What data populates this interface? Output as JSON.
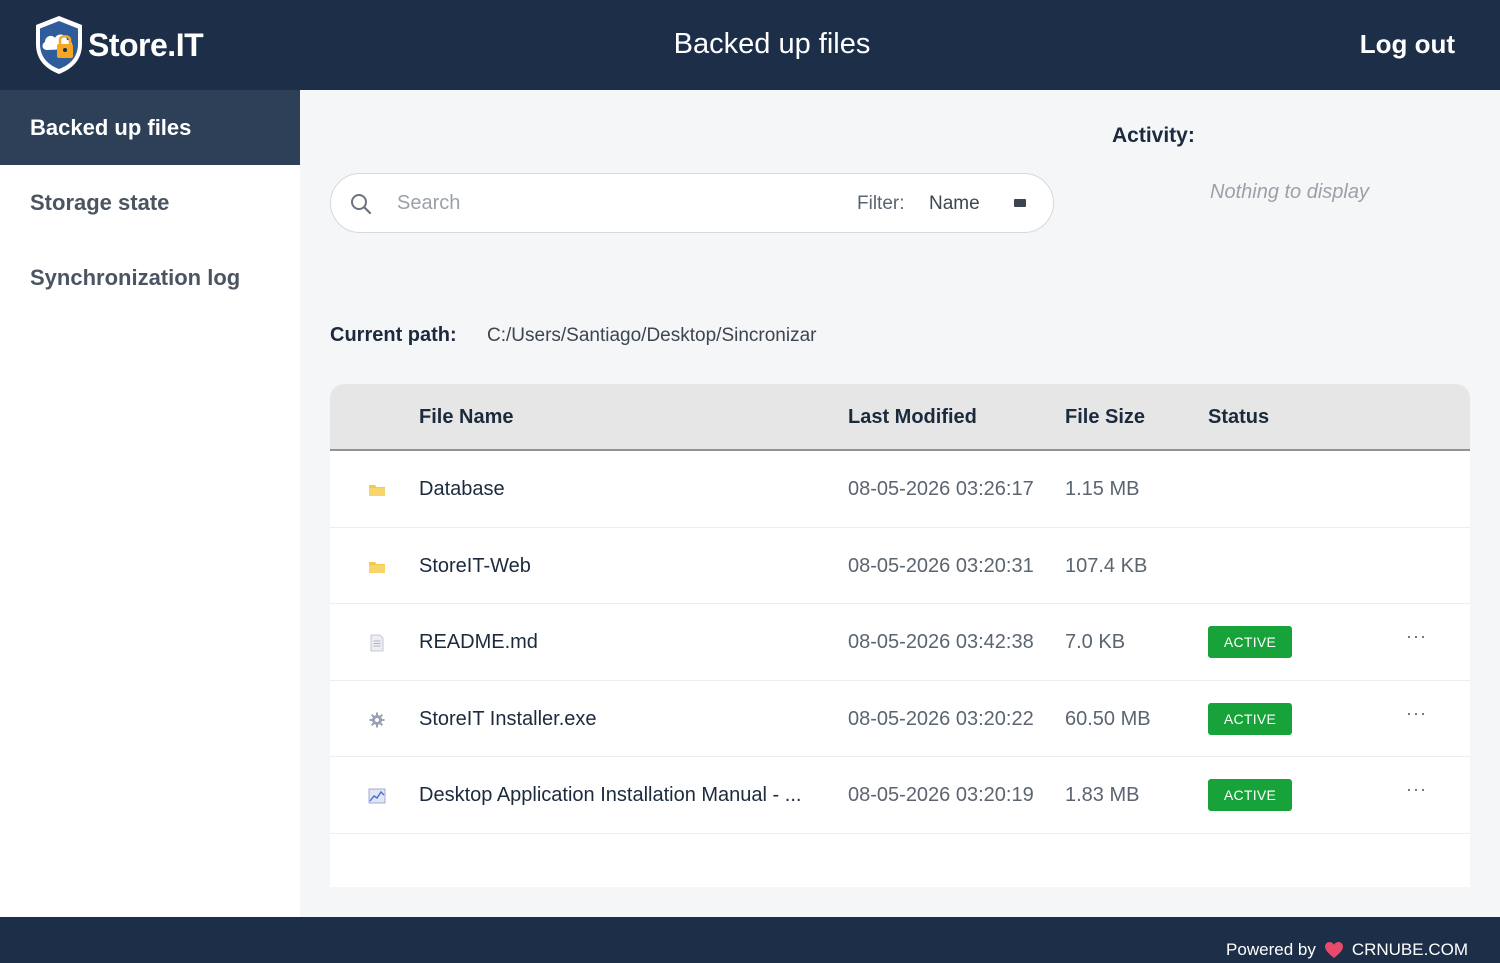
{
  "header": {
    "brand": "Store.IT",
    "title": "Backed up files",
    "logout_label": "Log out"
  },
  "sidebar": {
    "items": [
      {
        "label": "Backed up files",
        "active": true
      },
      {
        "label": "Storage state",
        "active": false
      },
      {
        "label": "Synchronization log",
        "active": false
      }
    ]
  },
  "search": {
    "placeholder": "Search",
    "value": "",
    "filter_label": "Filter:",
    "filter_value": "Name"
  },
  "activity": {
    "title": "Activity:",
    "empty_text": "Nothing to display"
  },
  "path": {
    "label": "Current path:",
    "value": "C:/Users/Santiago/Desktop/Sincronizar"
  },
  "table": {
    "columns": [
      "File Name",
      "Last Modified",
      "File Size",
      "Status"
    ],
    "rows": [
      {
        "icon": "folder-icon",
        "name": "Database",
        "modified": "08-05-2026 03:26:17",
        "size": "1.15 MB",
        "status": ""
      },
      {
        "icon": "folder-icon",
        "name": "StoreIT-Web",
        "modified": "08-05-2026 03:20:31",
        "size": "107.4 KB",
        "status": ""
      },
      {
        "icon": "document-icon",
        "name": "README.md",
        "modified": "08-05-2026 03:42:38",
        "size": "7.0 KB",
        "status": "ACTIVE"
      },
      {
        "icon": "gear-icon",
        "name": "StoreIT Installer.exe",
        "modified": "08-05-2026 03:20:22",
        "size": "60.50 MB",
        "status": "ACTIVE"
      },
      {
        "icon": "image-icon",
        "name": "Desktop Application Installation Manual - ...",
        "modified": "08-05-2026 03:20:19",
        "size": "1.83 MB",
        "status": "ACTIVE"
      }
    ],
    "more_label": "···"
  },
  "footer": {
    "powered_by": "Powered by",
    "brand": "CRNUBE.COM"
  },
  "colors": {
    "header_bg": "#1c2e48",
    "sidebar_active_bg": "#2e3f58",
    "status_active": "#17a33a",
    "folder": "#f2c94c"
  }
}
